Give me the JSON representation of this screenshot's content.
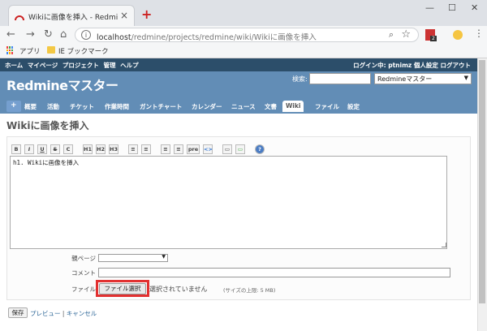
{
  "browser": {
    "tab_title": "Wikiに画像を挿入 - Redmineマス",
    "url_host": "localhost",
    "url_path": "/redmine/projects/redmine/wiki/Wikiに画像を挿入",
    "bookmarks": [
      "アプリ",
      "IE ブックマーク"
    ],
    "ext_badge": "2",
    "colors": {
      "tab_favicon": "#cc2222"
    }
  },
  "top_menu": {
    "left": "ホーム マイページ プロジェクト 管理 ヘルプ",
    "right": "ログイン中: ptnimz  個人設定 ログアウト"
  },
  "header": {
    "title": "Redmineマスター",
    "search_label": "検索:",
    "project_jump": "Redmineマスター"
  },
  "main_menu": {
    "plus": "+",
    "items": [
      "概要",
      "活動",
      "チケット",
      "作業時間",
      "ガントチャート",
      "カレンダー",
      "ニュース",
      "文書",
      "Wiki",
      "ファイル",
      "設定"
    ],
    "selected": "Wiki"
  },
  "page": {
    "title": "Wikiに画像を挿入",
    "toolbar": [
      "B",
      "I",
      "U",
      "S",
      "C",
      "H1",
      "H2",
      "H3",
      "≡",
      "≡",
      "≡",
      "≡",
      "pre",
      "<>",
      "▭",
      "▭",
      "?"
    ],
    "editor_text": "h1. Wikiに画像を挿入",
    "parent_label": "親ページ",
    "comment_label": "コメント",
    "file_label": "ファイル",
    "file_button": "ファイル選択",
    "file_none": "選択されていません",
    "file_max": "(サイズの上限: 5 MB)",
    "save": "保存",
    "preview": "プレビュー",
    "separator": "|",
    "cancel": "キャンセル"
  },
  "colors": {
    "header": "#628db6",
    "top_bar": "#2c4e6a",
    "highlight": "#e23131"
  }
}
